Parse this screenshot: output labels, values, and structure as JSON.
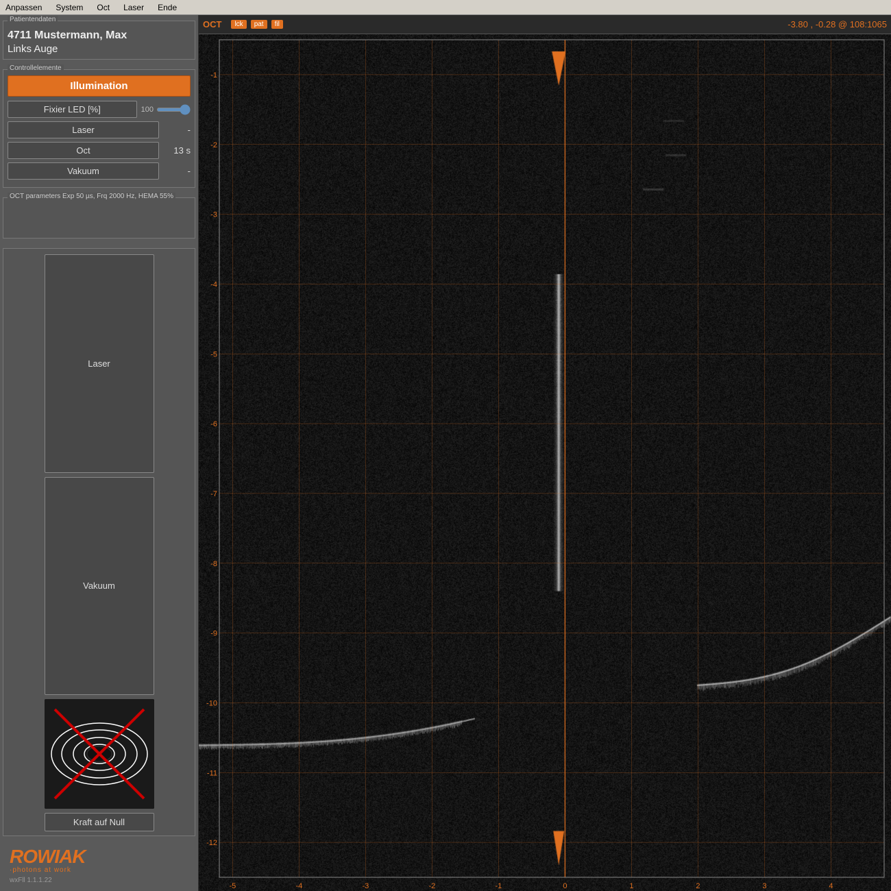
{
  "menubar": {
    "items": [
      "Anpassen",
      "System",
      "Oct",
      "Laser",
      "Ende"
    ]
  },
  "patient": {
    "section_label": "Patientendaten",
    "id": "4711 Mustermann, Max",
    "eye": "Links Auge"
  },
  "controls": {
    "section_label": "Controllelemente",
    "illumination_label": "Illumination",
    "fixier_label": "Fixier LED [%]",
    "fixier_value": "100",
    "laser_label": "Laser",
    "laser_value": "-",
    "oct_label": "Oct",
    "oct_value": "13 s",
    "vakuum_label": "Vakuum",
    "vakuum_value": "-"
  },
  "oct_params": {
    "section_label": "OCT parameters Exp 50 µs, Frq 2000 Hz, HEMA 55%"
  },
  "lower_panel": {
    "laser_button": "Laser",
    "vakuum_button": "Vakuum",
    "kraft_button": "Kraft auf Null"
  },
  "oct_view": {
    "title": "OCT",
    "badges": [
      "lck",
      "pat",
      "fil"
    ],
    "badge_active": [
      0,
      1,
      2
    ],
    "coords": "-3.80 ,  -0.28 @ 108:1065",
    "y_labels": [
      "-12",
      "-11",
      "-10",
      "-9",
      "-8",
      "-7",
      "-6",
      "-5",
      "-4",
      "-3",
      "-2",
      "-1"
    ],
    "x_labels": [
      "5",
      "4",
      "3",
      "2",
      "1",
      "0",
      "1",
      "2",
      "3",
      "4"
    ]
  },
  "logo": {
    "brand": "ROWIAK",
    "sub": "·photons at work",
    "version": "wxFll 1.1.1.22"
  }
}
